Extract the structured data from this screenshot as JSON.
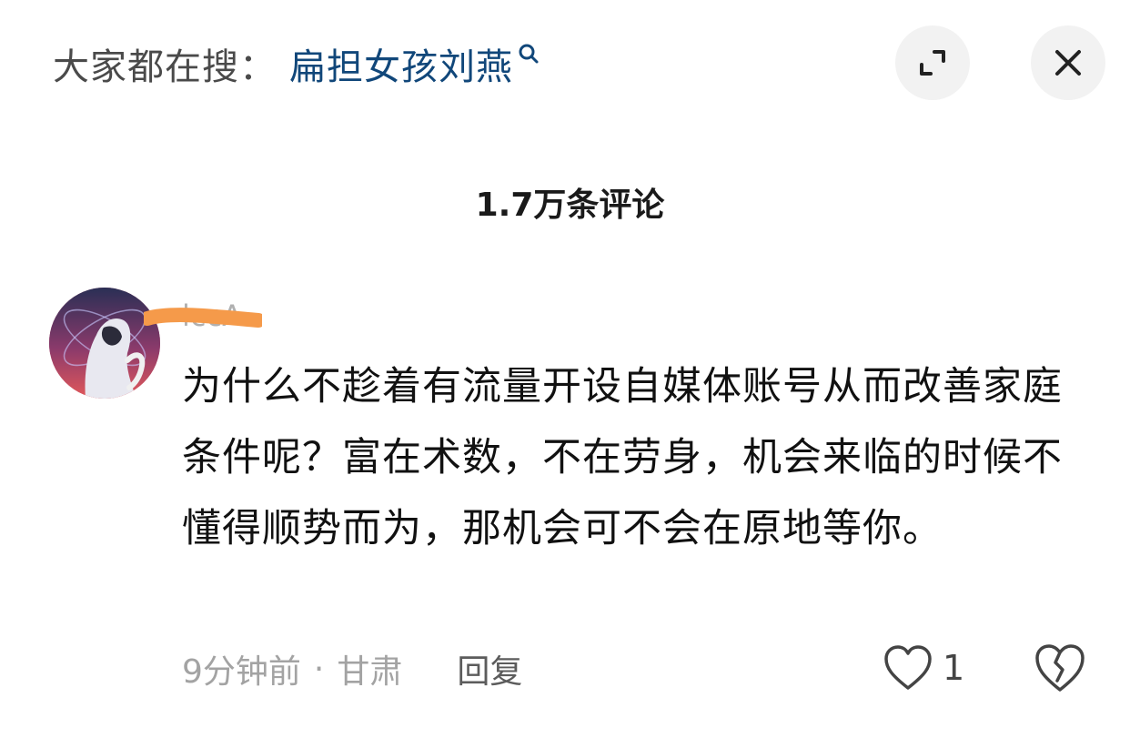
{
  "header": {
    "search_prefix": "大家都在搜：",
    "search_term": "扁担女孩刘燕"
  },
  "comments_title": "1.7万条评论",
  "comment": {
    "username": "lccA",
    "text": "为什么不趁着有流量开设自媒体账号从而改善家庭条件呢？富在术数，不在劳身，机会来临的时候不懂得顺势而为，那机会可不会在原地等你。",
    "time": "9分钟前",
    "separator": "·",
    "location": "甘肃",
    "reply_label": "回复",
    "like_count": "1"
  },
  "icons": {
    "search": "search-icon",
    "expand": "expand-icon",
    "close": "close-icon",
    "like": "heart-icon",
    "dislike": "broken-heart-icon"
  },
  "colors": {
    "search_term": "#11477a",
    "redaction": "#f59a4a",
    "button_bg": "#f2f2f2"
  }
}
